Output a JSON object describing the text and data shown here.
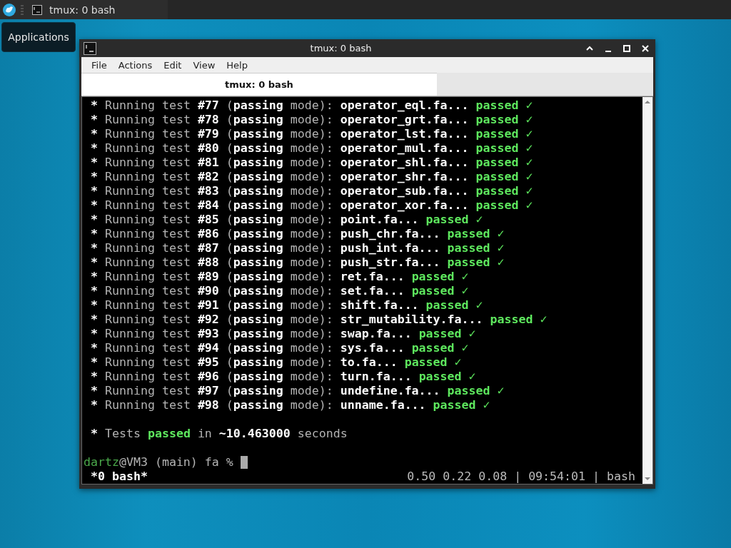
{
  "taskbar": {
    "task_title": "tmux: 0 bash",
    "menu_label": "Applications"
  },
  "window": {
    "title": "tmux: 0 bash",
    "menu": [
      "File",
      "Actions",
      "Edit",
      "View",
      "Help"
    ],
    "tabs": [
      {
        "label": "tmux: 0 bash",
        "selected": true
      }
    ],
    "terminal": {
      "lines": [
        {
          "segments": [
            {
              "kind": "bold",
              "text": "*"
            },
            {
              "kind": "dim",
              "text": " Running test "
            },
            {
              "kind": "bold",
              "text": "#77"
            },
            {
              "kind": "dim",
              "text": " ("
            },
            {
              "kind": "bold",
              "text": "passing"
            },
            {
              "kind": "dim",
              "text": " mode): "
            },
            {
              "kind": "bold",
              "text": "operator_eql.fa... "
            },
            {
              "kind": "pass",
              "text": "passed ✓"
            }
          ]
        },
        {
          "segments": [
            {
              "kind": "bold",
              "text": "*"
            },
            {
              "kind": "dim",
              "text": " Running test "
            },
            {
              "kind": "bold",
              "text": "#78"
            },
            {
              "kind": "dim",
              "text": " ("
            },
            {
              "kind": "bold",
              "text": "passing"
            },
            {
              "kind": "dim",
              "text": " mode): "
            },
            {
              "kind": "bold",
              "text": "operator_grt.fa... "
            },
            {
              "kind": "pass",
              "text": "passed ✓"
            }
          ]
        },
        {
          "segments": [
            {
              "kind": "bold",
              "text": "*"
            },
            {
              "kind": "dim",
              "text": " Running test "
            },
            {
              "kind": "bold",
              "text": "#79"
            },
            {
              "kind": "dim",
              "text": " ("
            },
            {
              "kind": "bold",
              "text": "passing"
            },
            {
              "kind": "dim",
              "text": " mode): "
            },
            {
              "kind": "bold",
              "text": "operator_lst.fa... "
            },
            {
              "kind": "pass",
              "text": "passed ✓"
            }
          ]
        },
        {
          "segments": [
            {
              "kind": "bold",
              "text": "*"
            },
            {
              "kind": "dim",
              "text": " Running test "
            },
            {
              "kind": "bold",
              "text": "#80"
            },
            {
              "kind": "dim",
              "text": " ("
            },
            {
              "kind": "bold",
              "text": "passing"
            },
            {
              "kind": "dim",
              "text": " mode): "
            },
            {
              "kind": "bold",
              "text": "operator_mul.fa... "
            },
            {
              "kind": "pass",
              "text": "passed ✓"
            }
          ]
        },
        {
          "segments": [
            {
              "kind": "bold",
              "text": "*"
            },
            {
              "kind": "dim",
              "text": " Running test "
            },
            {
              "kind": "bold",
              "text": "#81"
            },
            {
              "kind": "dim",
              "text": " ("
            },
            {
              "kind": "bold",
              "text": "passing"
            },
            {
              "kind": "dim",
              "text": " mode): "
            },
            {
              "kind": "bold",
              "text": "operator_shl.fa... "
            },
            {
              "kind": "pass",
              "text": "passed ✓"
            }
          ]
        },
        {
          "segments": [
            {
              "kind": "bold",
              "text": "*"
            },
            {
              "kind": "dim",
              "text": " Running test "
            },
            {
              "kind": "bold",
              "text": "#82"
            },
            {
              "kind": "dim",
              "text": " ("
            },
            {
              "kind": "bold",
              "text": "passing"
            },
            {
              "kind": "dim",
              "text": " mode): "
            },
            {
              "kind": "bold",
              "text": "operator_shr.fa... "
            },
            {
              "kind": "pass",
              "text": "passed ✓"
            }
          ]
        },
        {
          "segments": [
            {
              "kind": "bold",
              "text": "*"
            },
            {
              "kind": "dim",
              "text": " Running test "
            },
            {
              "kind": "bold",
              "text": "#83"
            },
            {
              "kind": "dim",
              "text": " ("
            },
            {
              "kind": "bold",
              "text": "passing"
            },
            {
              "kind": "dim",
              "text": " mode): "
            },
            {
              "kind": "bold",
              "text": "operator_sub.fa... "
            },
            {
              "kind": "pass",
              "text": "passed ✓"
            }
          ]
        },
        {
          "segments": [
            {
              "kind": "bold",
              "text": "*"
            },
            {
              "kind": "dim",
              "text": " Running test "
            },
            {
              "kind": "bold",
              "text": "#84"
            },
            {
              "kind": "dim",
              "text": " ("
            },
            {
              "kind": "bold",
              "text": "passing"
            },
            {
              "kind": "dim",
              "text": " mode): "
            },
            {
              "kind": "bold",
              "text": "operator_xor.fa... "
            },
            {
              "kind": "pass",
              "text": "passed ✓"
            }
          ]
        },
        {
          "segments": [
            {
              "kind": "bold",
              "text": "*"
            },
            {
              "kind": "dim",
              "text": " Running test "
            },
            {
              "kind": "bold",
              "text": "#85"
            },
            {
              "kind": "dim",
              "text": " ("
            },
            {
              "kind": "bold",
              "text": "passing"
            },
            {
              "kind": "dim",
              "text": " mode): "
            },
            {
              "kind": "bold",
              "text": "point.fa... "
            },
            {
              "kind": "pass",
              "text": "passed ✓"
            }
          ]
        },
        {
          "segments": [
            {
              "kind": "bold",
              "text": "*"
            },
            {
              "kind": "dim",
              "text": " Running test "
            },
            {
              "kind": "bold",
              "text": "#86"
            },
            {
              "kind": "dim",
              "text": " ("
            },
            {
              "kind": "bold",
              "text": "passing"
            },
            {
              "kind": "dim",
              "text": " mode): "
            },
            {
              "kind": "bold",
              "text": "push_chr.fa... "
            },
            {
              "kind": "pass",
              "text": "passed ✓"
            }
          ]
        },
        {
          "segments": [
            {
              "kind": "bold",
              "text": "*"
            },
            {
              "kind": "dim",
              "text": " Running test "
            },
            {
              "kind": "bold",
              "text": "#87"
            },
            {
              "kind": "dim",
              "text": " ("
            },
            {
              "kind": "bold",
              "text": "passing"
            },
            {
              "kind": "dim",
              "text": " mode): "
            },
            {
              "kind": "bold",
              "text": "push_int.fa... "
            },
            {
              "kind": "pass",
              "text": "passed ✓"
            }
          ]
        },
        {
          "segments": [
            {
              "kind": "bold",
              "text": "*"
            },
            {
              "kind": "dim",
              "text": " Running test "
            },
            {
              "kind": "bold",
              "text": "#88"
            },
            {
              "kind": "dim",
              "text": " ("
            },
            {
              "kind": "bold",
              "text": "passing"
            },
            {
              "kind": "dim",
              "text": " mode): "
            },
            {
              "kind": "bold",
              "text": "push_str.fa... "
            },
            {
              "kind": "pass",
              "text": "passed ✓"
            }
          ]
        },
        {
          "segments": [
            {
              "kind": "bold",
              "text": "*"
            },
            {
              "kind": "dim",
              "text": " Running test "
            },
            {
              "kind": "bold",
              "text": "#89"
            },
            {
              "kind": "dim",
              "text": " ("
            },
            {
              "kind": "bold",
              "text": "passing"
            },
            {
              "kind": "dim",
              "text": " mode): "
            },
            {
              "kind": "bold",
              "text": "ret.fa... "
            },
            {
              "kind": "pass",
              "text": "passed ✓"
            }
          ]
        },
        {
          "segments": [
            {
              "kind": "bold",
              "text": "*"
            },
            {
              "kind": "dim",
              "text": " Running test "
            },
            {
              "kind": "bold",
              "text": "#90"
            },
            {
              "kind": "dim",
              "text": " ("
            },
            {
              "kind": "bold",
              "text": "passing"
            },
            {
              "kind": "dim",
              "text": " mode): "
            },
            {
              "kind": "bold",
              "text": "set.fa... "
            },
            {
              "kind": "pass",
              "text": "passed ✓"
            }
          ]
        },
        {
          "segments": [
            {
              "kind": "bold",
              "text": "*"
            },
            {
              "kind": "dim",
              "text": " Running test "
            },
            {
              "kind": "bold",
              "text": "#91"
            },
            {
              "kind": "dim",
              "text": " ("
            },
            {
              "kind": "bold",
              "text": "passing"
            },
            {
              "kind": "dim",
              "text": " mode): "
            },
            {
              "kind": "bold",
              "text": "shift.fa... "
            },
            {
              "kind": "pass",
              "text": "passed ✓"
            }
          ]
        },
        {
          "segments": [
            {
              "kind": "bold",
              "text": "*"
            },
            {
              "kind": "dim",
              "text": " Running test "
            },
            {
              "kind": "bold",
              "text": "#92"
            },
            {
              "kind": "dim",
              "text": " ("
            },
            {
              "kind": "bold",
              "text": "passing"
            },
            {
              "kind": "dim",
              "text": " mode): "
            },
            {
              "kind": "bold",
              "text": "str_mutability.fa... "
            },
            {
              "kind": "pass",
              "text": "passed ✓"
            }
          ]
        },
        {
          "segments": [
            {
              "kind": "bold",
              "text": "*"
            },
            {
              "kind": "dim",
              "text": " Running test "
            },
            {
              "kind": "bold",
              "text": "#93"
            },
            {
              "kind": "dim",
              "text": " ("
            },
            {
              "kind": "bold",
              "text": "passing"
            },
            {
              "kind": "dim",
              "text": " mode): "
            },
            {
              "kind": "bold",
              "text": "swap.fa... "
            },
            {
              "kind": "pass",
              "text": "passed ✓"
            }
          ]
        },
        {
          "segments": [
            {
              "kind": "bold",
              "text": "*"
            },
            {
              "kind": "dim",
              "text": " Running test "
            },
            {
              "kind": "bold",
              "text": "#94"
            },
            {
              "kind": "dim",
              "text": " ("
            },
            {
              "kind": "bold",
              "text": "passing"
            },
            {
              "kind": "dim",
              "text": " mode): "
            },
            {
              "kind": "bold",
              "text": "sys.fa... "
            },
            {
              "kind": "pass",
              "text": "passed ✓"
            }
          ]
        },
        {
          "segments": [
            {
              "kind": "bold",
              "text": "*"
            },
            {
              "kind": "dim",
              "text": " Running test "
            },
            {
              "kind": "bold",
              "text": "#95"
            },
            {
              "kind": "dim",
              "text": " ("
            },
            {
              "kind": "bold",
              "text": "passing"
            },
            {
              "kind": "dim",
              "text": " mode): "
            },
            {
              "kind": "bold",
              "text": "to.fa... "
            },
            {
              "kind": "pass",
              "text": "passed ✓"
            }
          ]
        },
        {
          "segments": [
            {
              "kind": "bold",
              "text": "*"
            },
            {
              "kind": "dim",
              "text": " Running test "
            },
            {
              "kind": "bold",
              "text": "#96"
            },
            {
              "kind": "dim",
              "text": " ("
            },
            {
              "kind": "bold",
              "text": "passing"
            },
            {
              "kind": "dim",
              "text": " mode): "
            },
            {
              "kind": "bold",
              "text": "turn.fa... "
            },
            {
              "kind": "pass",
              "text": "passed ✓"
            }
          ]
        },
        {
          "segments": [
            {
              "kind": "bold",
              "text": "*"
            },
            {
              "kind": "dim",
              "text": " Running test "
            },
            {
              "kind": "bold",
              "text": "#97"
            },
            {
              "kind": "dim",
              "text": " ("
            },
            {
              "kind": "bold",
              "text": "passing"
            },
            {
              "kind": "dim",
              "text": " mode): "
            },
            {
              "kind": "bold",
              "text": "undefine.fa... "
            },
            {
              "kind": "pass",
              "text": "passed ✓"
            }
          ]
        },
        {
          "segments": [
            {
              "kind": "bold",
              "text": "*"
            },
            {
              "kind": "dim",
              "text": " Running test "
            },
            {
              "kind": "bold",
              "text": "#98"
            },
            {
              "kind": "dim",
              "text": " ("
            },
            {
              "kind": "bold",
              "text": "passing"
            },
            {
              "kind": "dim",
              "text": " mode): "
            },
            {
              "kind": "bold",
              "text": "unname.fa... "
            },
            {
              "kind": "pass",
              "text": "passed ✓"
            }
          ]
        },
        {
          "gap_before": true,
          "segments": [
            {
              "kind": "bold",
              "text": "*"
            },
            {
              "kind": "dim",
              "text": " Tests "
            },
            {
              "kind": "pass",
              "text": "passed"
            },
            {
              "kind": "dim",
              "text": " in "
            },
            {
              "kind": "bold",
              "text": "~10.463000"
            },
            {
              "kind": "dim",
              "text": " seconds"
            }
          ]
        },
        {
          "gap_before": true,
          "segments": [
            {
              "kind": "user",
              "text": "dartz"
            },
            {
              "kind": "dim",
              "text": "@VM3 (main) fa % "
            }
          ],
          "cursor": true
        }
      ],
      "status_left": "*0 bash*",
      "status_right": "0.50 0.22 0.08 | 09:54:01 | bash"
    }
  }
}
